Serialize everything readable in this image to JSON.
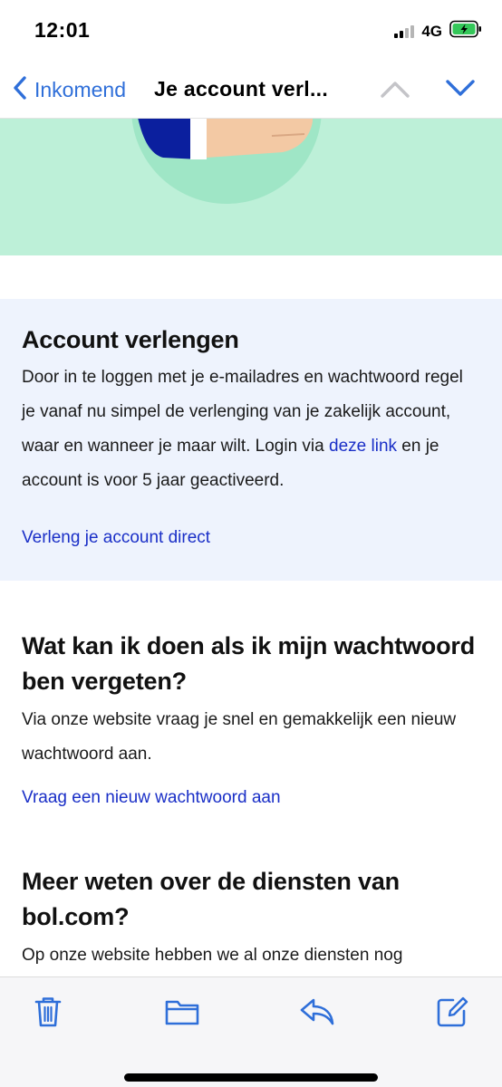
{
  "status": {
    "time": "12:01",
    "network": "4G",
    "signal_icon": "cellular-signal-icon",
    "battery_icon": "battery-charging-icon"
  },
  "nav": {
    "back_label": "Inkomend",
    "title": "Je account verl...",
    "back_icon": "chevron-left-icon",
    "prev_icon": "chevron-up-icon",
    "next_icon": "chevron-down-icon",
    "accent_color": "#2f6fd9"
  },
  "hero": {
    "background_color": "#bdf0d8"
  },
  "card": {
    "title": "Account verlengen",
    "body_before_link": "Door in te loggen met je e-mailadres en wachtwoord regel je vanaf nu simpel de verlenging van je zakelijk account, waar en wanneer je maar wilt. Login via ",
    "body_link": "deze link",
    "body_after_link": " en je account is voor 5 jaar geactiveerd.",
    "cta": "Verleng je account direct",
    "background_color": "#eef3fd",
    "link_color": "#1a2fc7"
  },
  "section_password": {
    "title": "Wat kan ik doen als ik mijn wachtwoord ben vergeten?",
    "body": "Via onze website vraag je snel en gemakkelijk een nieuw wachtwoord aan.",
    "cta": "Vraag een nieuw wachtwoord aan"
  },
  "section_services": {
    "title": "Meer weten over de diensten van bol.com?",
    "body": "Op onze website hebben we al onze diensten nog"
  },
  "toolbar": {
    "items": [
      {
        "icon": "trash-icon"
      },
      {
        "icon": "folder-icon"
      },
      {
        "icon": "reply-icon"
      },
      {
        "icon": "compose-icon"
      }
    ]
  }
}
